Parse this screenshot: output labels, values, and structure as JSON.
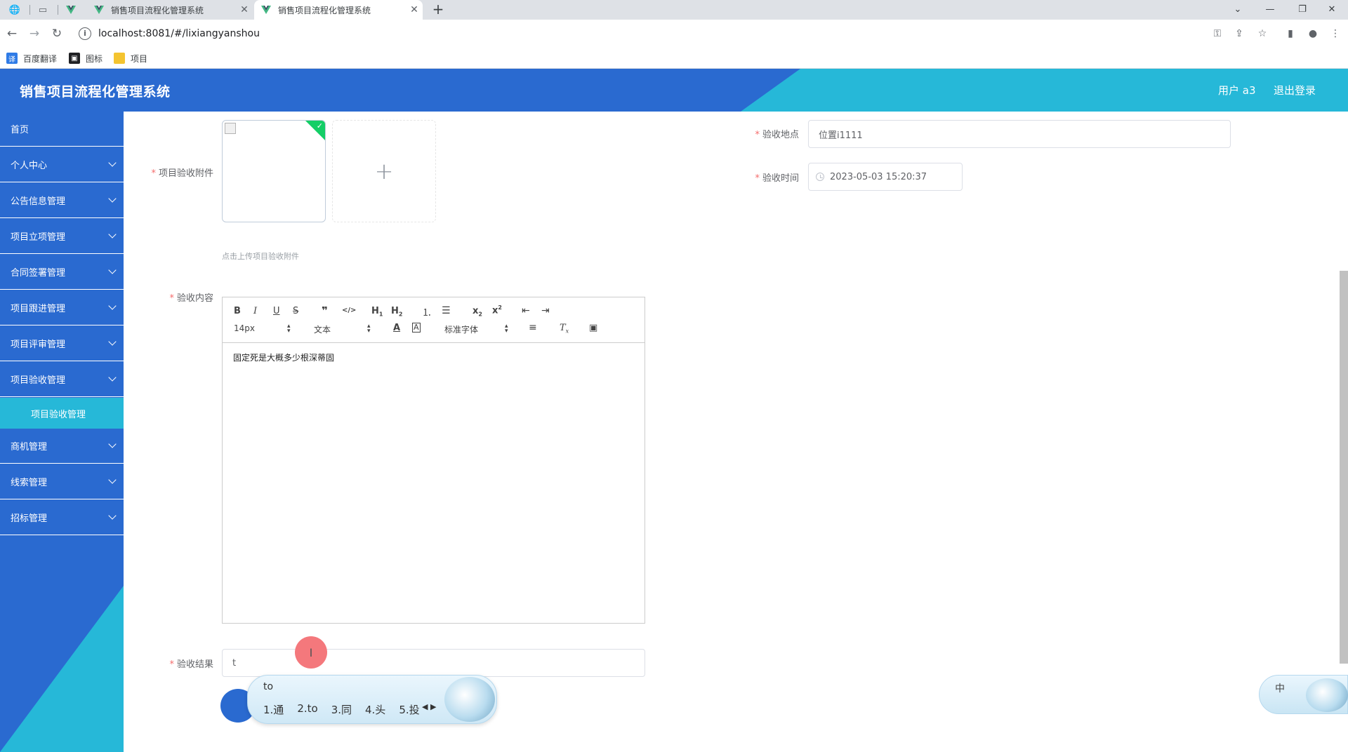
{
  "browser": {
    "tabs": [
      {
        "title": "销售项目流程化管理系统",
        "active": false
      },
      {
        "title": "销售项目流程化管理系统",
        "active": true
      }
    ],
    "new_tab_symbol": "+",
    "close_symbol": "✕",
    "url": "localhost:8081/#/lixiangyanshou",
    "bookmarks": [
      {
        "label": "百度翻译",
        "icon": "translate-icon",
        "color": "#2f7be6"
      },
      {
        "label": "图标",
        "icon": "iconfont-icon",
        "color": "#202124"
      },
      {
        "label": "项目",
        "icon": "folder-icon",
        "color": "#f4c430"
      }
    ]
  },
  "header": {
    "title": "销售项目流程化管理系统",
    "user": "用户 a3",
    "logout": "退出登录"
  },
  "sidebar": {
    "items": [
      {
        "label": "首页",
        "expandable": false
      },
      {
        "label": "个人中心",
        "expandable": true
      },
      {
        "label": "公告信息管理",
        "expandable": true
      },
      {
        "label": "项目立项管理",
        "expandable": true
      },
      {
        "label": "合同签署管理",
        "expandable": true
      },
      {
        "label": "项目跟进管理",
        "expandable": true
      },
      {
        "label": "项目评审管理",
        "expandable": true
      },
      {
        "label": "项目验收管理",
        "expandable": true
      }
    ],
    "sub_item": "项目验收管理",
    "items_after": [
      {
        "label": "商机管理",
        "expandable": true
      },
      {
        "label": "线索管理",
        "expandable": true
      },
      {
        "label": "招标管理",
        "expandable": true
      }
    ]
  },
  "form": {
    "attachment_label": "项目验收附件",
    "attachment_tip": "点击上传项目验收附件",
    "upload_plus": "+",
    "content_label": "验收内容",
    "editor": {
      "font_size": "14px",
      "text_type": "文本",
      "font_family": "标准字体",
      "content": "固定死是大概多少根深蒂固"
    },
    "result_label": "验收结果",
    "result_value": "t",
    "location_label": "验收地点",
    "location_value": "位置i1111",
    "time_label": "验收时间",
    "time_value": "2023-05-03 15:20:37",
    "required_mark": "*"
  },
  "ime": {
    "input": "to",
    "candidates": [
      "1.通",
      "2.to",
      "3.同",
      "4.头",
      "5.投"
    ],
    "pager": "◀ ▶",
    "status": "中"
  },
  "colors": {
    "sidebar_blue": "#2a6ad0",
    "accent_teal": "#26b8d8",
    "required_red": "#f56c6c",
    "success_green": "#13ce66"
  }
}
